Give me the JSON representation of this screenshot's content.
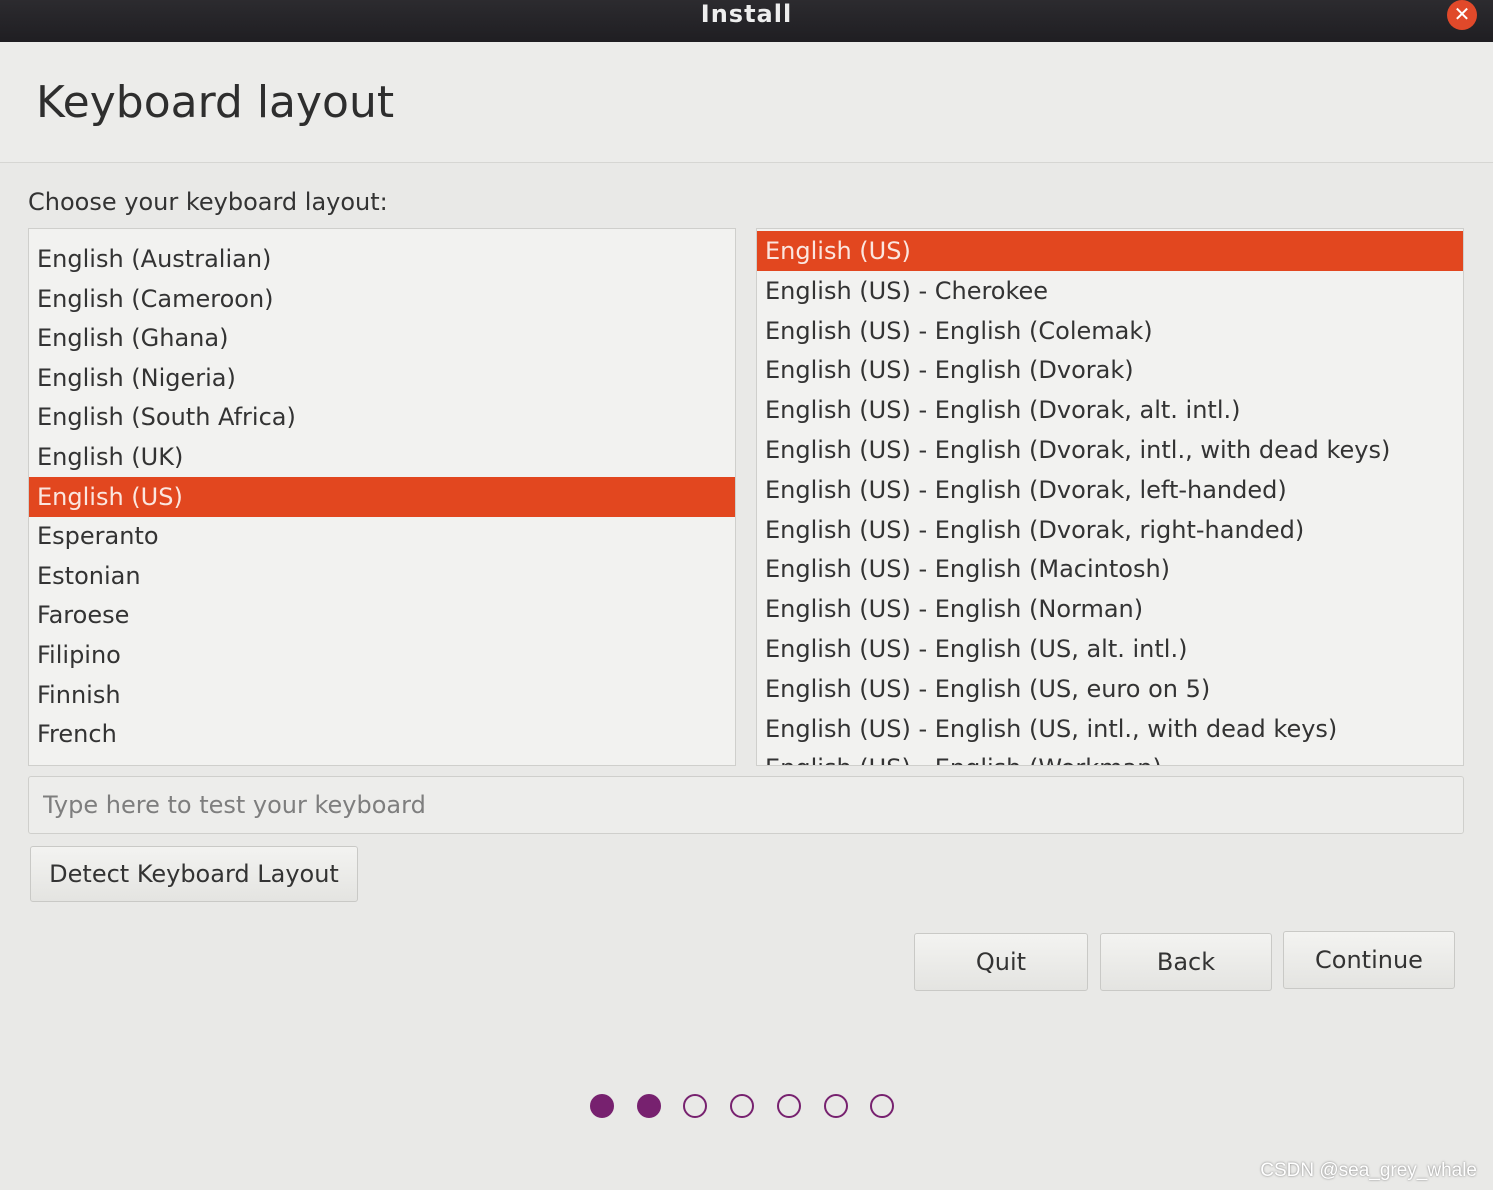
{
  "window": {
    "title": "Install",
    "close_symbol": "✕"
  },
  "page": {
    "title": "Keyboard layout",
    "prompt": "Choose your keyboard layout:"
  },
  "layouts": {
    "items": [
      "English (Australian)",
      "English (Cameroon)",
      "English (Ghana)",
      "English (Nigeria)",
      "English (South Africa)",
      "English (UK)",
      "English (US)",
      "Esperanto",
      "Estonian",
      "Faroese",
      "Filipino",
      "Finnish",
      "French"
    ],
    "selected": "English (US)"
  },
  "variants": {
    "items": [
      "English (US)",
      "English (US) - Cherokee",
      "English (US) - English (Colemak)",
      "English (US) - English (Dvorak)",
      "English (US) - English (Dvorak, alt. intl.)",
      "English (US) - English (Dvorak, intl., with dead keys)",
      "English (US) - English (Dvorak, left-handed)",
      "English (US) - English (Dvorak, right-handed)",
      "English (US) - English (Macintosh)",
      "English (US) - English (Norman)",
      "English (US) - English (US, alt. intl.)",
      "English (US) - English (US, euro on 5)",
      "English (US) - English (US, intl., with dead keys)",
      "English (US) - English (Workman)"
    ],
    "selected": "English (US)"
  },
  "test": {
    "placeholder": "Type here to test your keyboard",
    "value": ""
  },
  "buttons": {
    "detect": "Detect Keyboard Layout",
    "quit": "Quit",
    "back": "Back",
    "continue": "Continue"
  },
  "progress": {
    "total_steps": 7,
    "current_step": 2
  },
  "colors": {
    "accent": "#e2471f",
    "progress_dot": "#77216f"
  },
  "watermark": "CSDN @sea_grey_whale"
}
